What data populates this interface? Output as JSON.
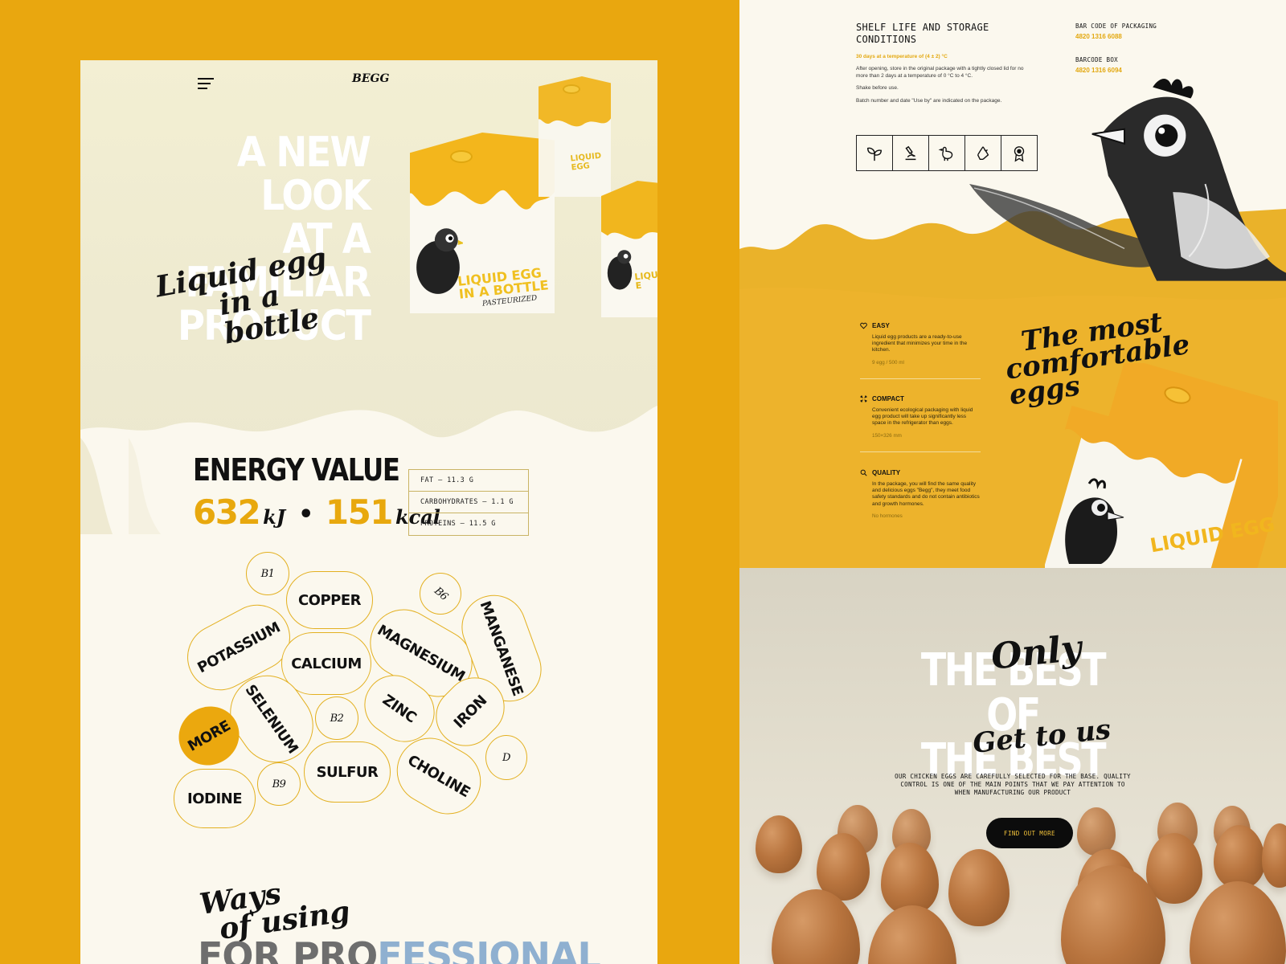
{
  "header": {
    "logo": "BEGG"
  },
  "hero": {
    "title_lines": [
      "A NEW LOOK",
      "AT A FAMILIAR",
      "PRODUCT"
    ],
    "script_line1": "Liquid egg",
    "script_line2": "in a bottle",
    "carton_label_line1": "LIQUID EGG",
    "carton_label_line2": "IN A BOTTLE",
    "carton_sub": "PASTEURIZED",
    "carton_label_short": "LIQUID E"
  },
  "energy": {
    "title": "ENERGY VALUE",
    "kj_value": "632",
    "kj_unit": "kJ",
    "separator": "•",
    "kcal_value": "151",
    "kcal_unit": "kcal",
    "nutrients": [
      "FAT – 11.3 G",
      "CARBOHYDRATES – 1.1 G",
      "PROTEINS – 11.5 G"
    ]
  },
  "minerals": {
    "items": [
      "B1",
      "COPPER",
      "B6",
      "POTASSIUM",
      "CALCIUM",
      "MAGNESIUM",
      "MANGANESE",
      "SELENIUM",
      "B2",
      "ZINC",
      "IRON",
      "MORE",
      "IODINE",
      "B9",
      "SULFUR",
      "CHOLINE",
      "D"
    ]
  },
  "ways": {
    "script_line1": "Ways",
    "script_line2": "of using",
    "professional_a": "FOR PRO",
    "professional_b": "FESSIONAL"
  },
  "storage": {
    "title": "SHELF LIFE AND STORAGE CONDITIONS",
    "temperature": "30 days at a temperature of (4 ± 2) °C",
    "paragraphs": [
      "After opening, store in the original package with a tightly closed lid for no more than 2 days at a temperature of 0 °C to 4 °C.",
      "Shake before use.",
      "Batch number and date \"Use by\" are indicated on the package."
    ],
    "barcode_packaging_label": "BAR CODE OF PACKAGING",
    "barcode_packaging_value": "4820 1316 6088",
    "barcode_box_label": "BARCODE BOX",
    "barcode_box_value": "4820 1316 6094",
    "cert_icons": [
      "leaf-icon",
      "microscope-icon",
      "chicken-icon",
      "recycle-icon",
      "award-icon"
    ]
  },
  "features": {
    "script_line1": "The most",
    "script_line2": "comfortable eggs",
    "items": [
      {
        "icon": "heart-icon",
        "title": "EASY",
        "text": "Liquid egg products are a ready-to-use ingredient that minimizes your time in the kitchen.",
        "note": "9 egg / 500 ml"
      },
      {
        "icon": "expand-icon",
        "title": "COMPACT",
        "text": "Convenient ecological packaging with liquid egg product will take up significantly less space in the refrigerator than eggs.",
        "note": "150×326 mm"
      },
      {
        "icon": "magnifier-icon",
        "title": "QUALITY",
        "text": "In the package, you will find the same quality and delicious eggs \"Begg\", they meet food safety standards and do not contain antibiotics and growth hormones.",
        "note": "No hormones"
      }
    ]
  },
  "best": {
    "script_top": "Only",
    "title_line1": "THE BEST OF",
    "title_line2": "THE BEST",
    "script_bottom": "Get to us",
    "description": "OUR CHICKEN EGGS ARE CAREFULLY SELECTED FOR THE BASE. QUALITY CONTROL IS ONE OF THE MAIN POINTS THAT WE PAY ATTENTION TO WHEN MANUFACTURING OUR PRODUCT",
    "button_label": "FIND OUT MORE"
  },
  "colors": {
    "accent_yellow": "#e9a70f",
    "cream": "#fbf8ee",
    "dark": "#111111"
  }
}
